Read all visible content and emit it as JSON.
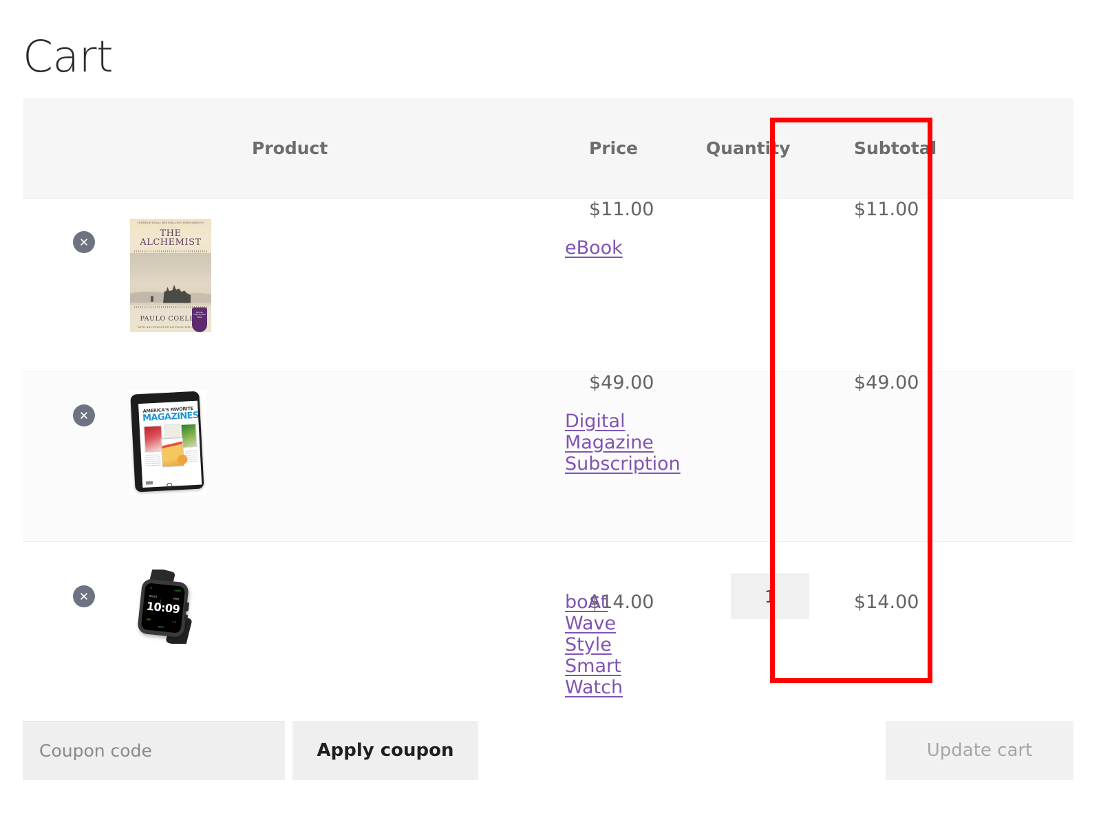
{
  "page": {
    "title": "Cart"
  },
  "table": {
    "headers": {
      "remove": "",
      "thumbnail": "",
      "product": "Product",
      "price": "Price",
      "quantity": "Quantity",
      "subtotal": "Subtotal"
    },
    "rows": [
      {
        "remove_icon": "remove-circle-x-icon",
        "thumbnail_alt": "the-alchemist-book-cover",
        "thumbnail_text": {
          "top_line": "INTERNATIONAL BESTSELLING PHENOMENON",
          "title_line1": "THE",
          "title_line2": "ALCHEMIST",
          "author": "PAULO COELHO",
          "subline": "WITH AN INTRODUCTION FROM THE AUTHOR",
          "badge": "Simple, Inspiring and Wise"
        },
        "name": "eBook",
        "price": "$11.00",
        "quantity": "",
        "subtotal": "$11.00"
      },
      {
        "remove_icon": "remove-circle-x-icon",
        "thumbnail_alt": "digital-magazine-tablet",
        "thumbnail_text": {
          "headline1": "AMERICA'S FAVORITE",
          "headline2": "MAGAZINES"
        },
        "name": "Digital Magazine Subscription",
        "price": "$49.00",
        "quantity": "",
        "subtotal": "$49.00"
      },
      {
        "remove_icon": "remove-circle-x-icon",
        "thumbnail_alt": "boat-wave-style-smart-watch",
        "thumbnail_text": {
          "time": "10:09",
          "date": "06/23",
          "day": "Wed",
          "metric_left_top": "78",
          "metric_right_top": "4,688",
          "metric_left_bottom": "180",
          "metric_right_bottom": "2.3",
          "battery": "80%"
        },
        "name": "boAt Wave Style Smart Watch",
        "price": "$14.00",
        "quantity": "1",
        "subtotal": "$14.00"
      }
    ]
  },
  "actions": {
    "coupon_placeholder": "Coupon code",
    "coupon_value": "",
    "apply_label": "Apply coupon",
    "update_label": "Update cart"
  },
  "annotation": {
    "shape": "rectangle",
    "target": "quantity-column",
    "color": "#fe0000"
  },
  "colors": {
    "link": "#7f54b3",
    "header_bg": "#f6f6f6",
    "text": "#636363",
    "annotation": "#fe0000"
  }
}
